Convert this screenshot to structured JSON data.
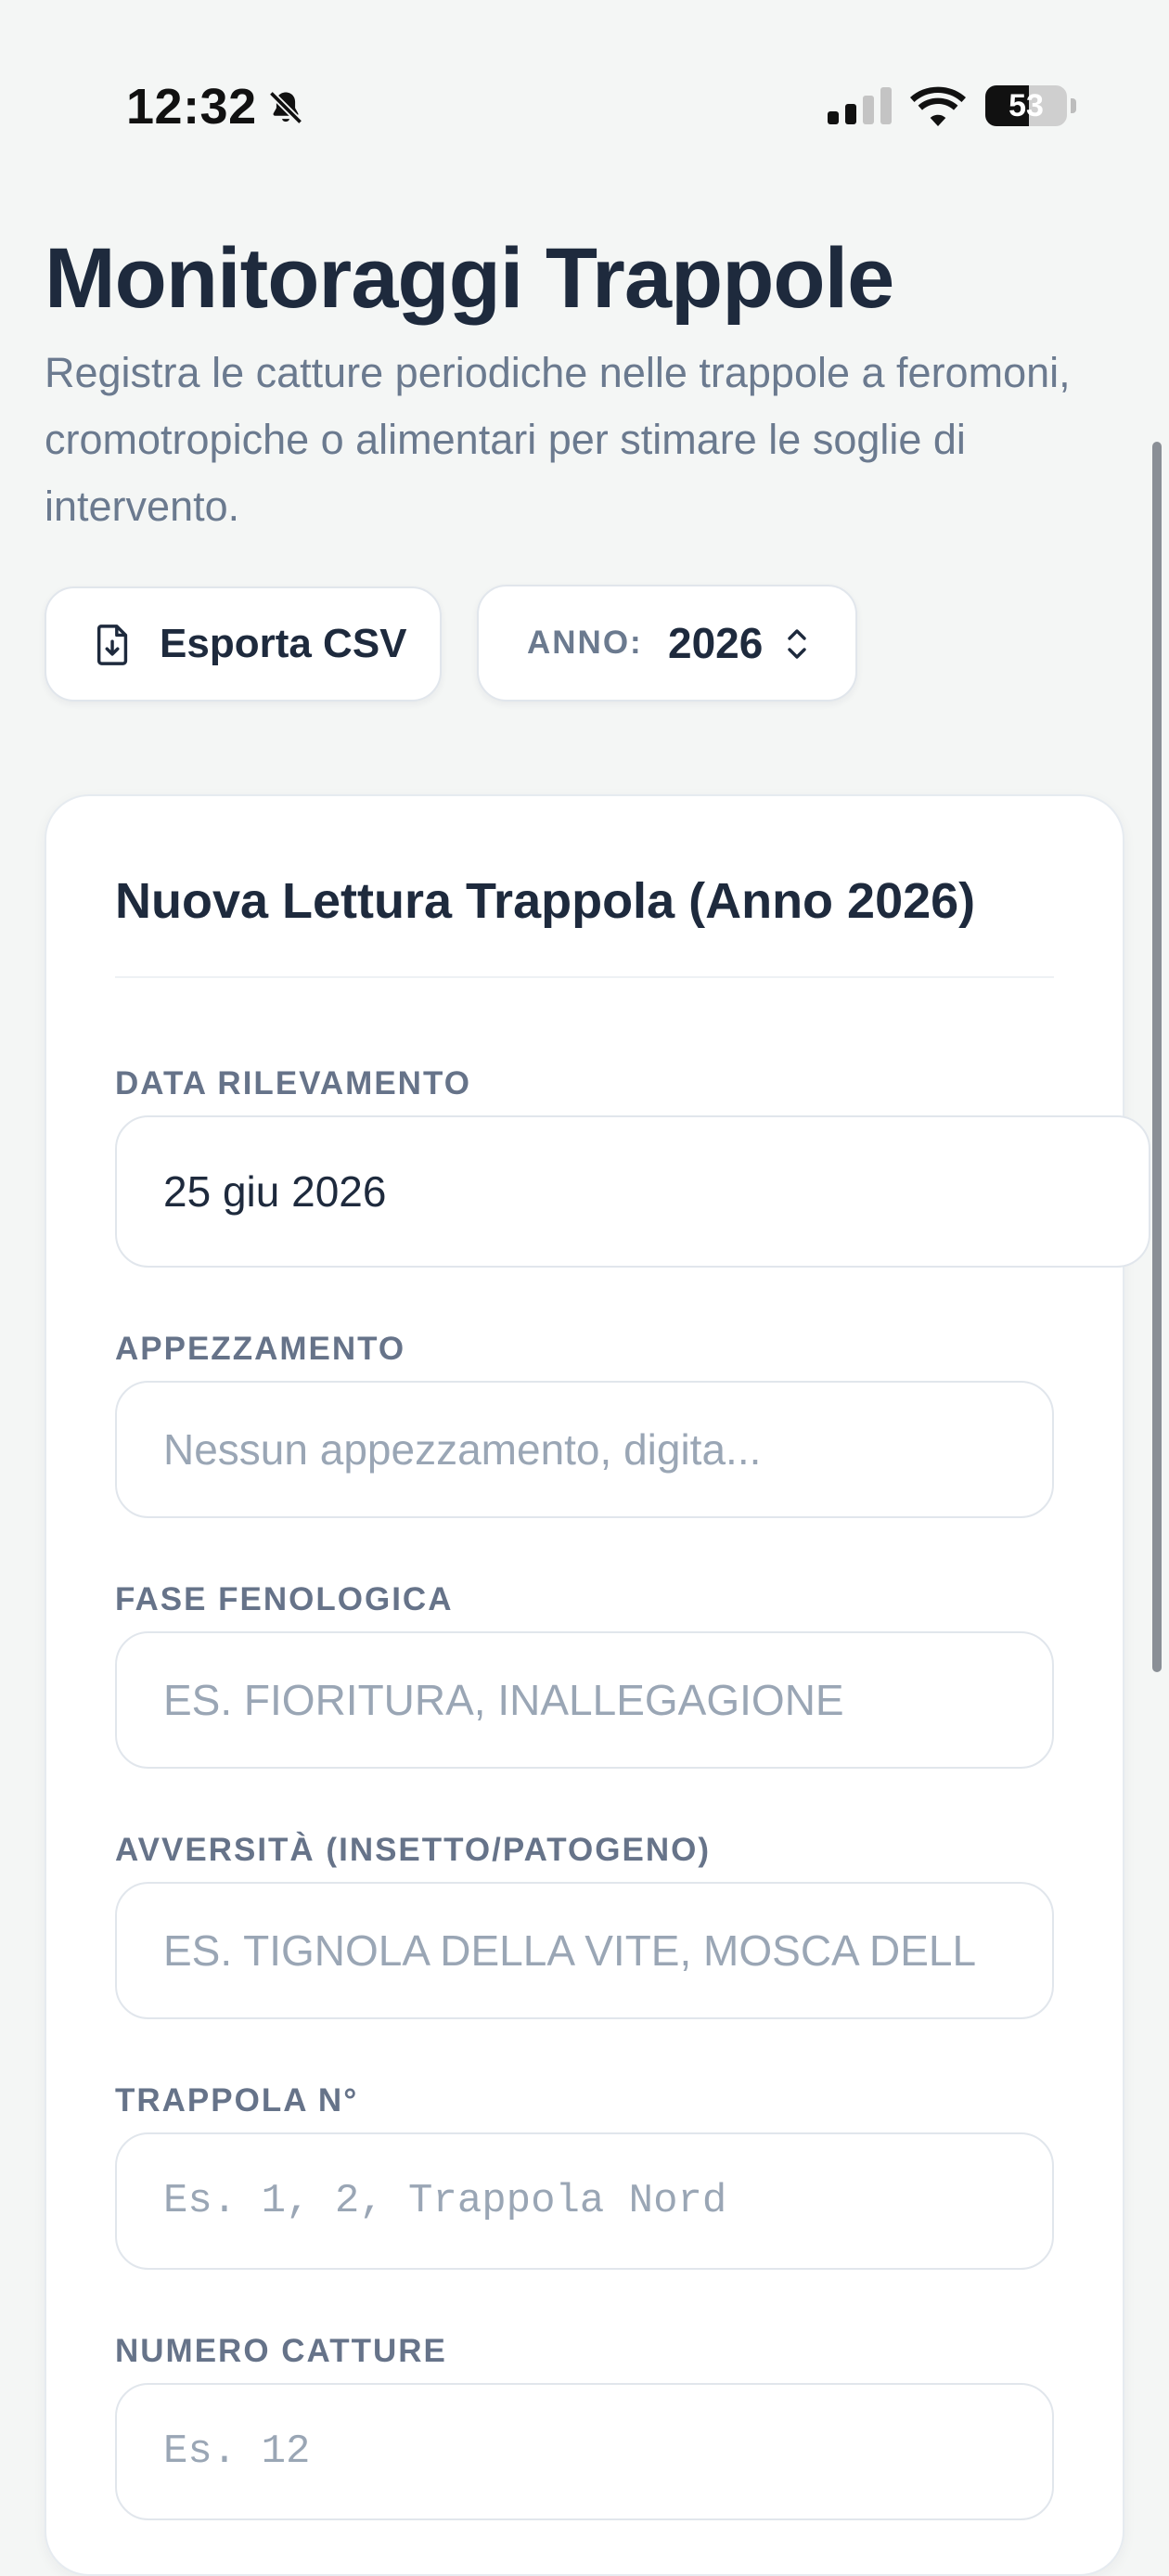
{
  "status_bar": {
    "time": "12:32",
    "battery_level": "53",
    "battery_fraction": 0.53
  },
  "header": {
    "title": "Monitoraggi Trappole",
    "subtitle": "Registra le catture periodiche nelle trappole a feromoni, cromotropiche o alimentari per stimare le soglie di intervento."
  },
  "toolbar": {
    "export_label": "Esporta CSV",
    "year_label": "ANNO:",
    "year_value": "2026"
  },
  "form": {
    "title": "Nuova Lettura Trappola (Anno 2026)",
    "fields": [
      {
        "label": "DATA RILEVAMENTO",
        "value": "25 giu 2026",
        "placeholder": ""
      },
      {
        "label": "APPEZZAMENTO",
        "value": "",
        "placeholder": "Nessun appezzamento, digita..."
      },
      {
        "label": "FASE FENOLOGICA",
        "value": "",
        "placeholder": "ES. FIORITURA, INALLEGAGIONE"
      },
      {
        "label": "AVVERSITÀ (INSETTO/PATOGENO)",
        "value": "",
        "placeholder": "ES. TIGNOLA DELLA VITE, MOSCA DELL"
      },
      {
        "label": "TRAPPOLA N°",
        "value": "",
        "placeholder": "Es. 1, 2, Trappola Nord"
      },
      {
        "label": "NUMERO CATTURE",
        "value": "",
        "placeholder": "Es. 12"
      }
    ]
  },
  "icons": {
    "bell": "bell-slash-icon",
    "signal": "cellular-signal-icon",
    "wifi": "wifi-icon",
    "export": "file-download-icon",
    "year_select": "chevron-up-down-icon"
  },
  "colors": {
    "background": "#f4f6f5",
    "title": "#1e2a3d",
    "muted": "#6b7a8f",
    "placeholder": "#9aa6b5",
    "border": "#e1e6ec"
  }
}
